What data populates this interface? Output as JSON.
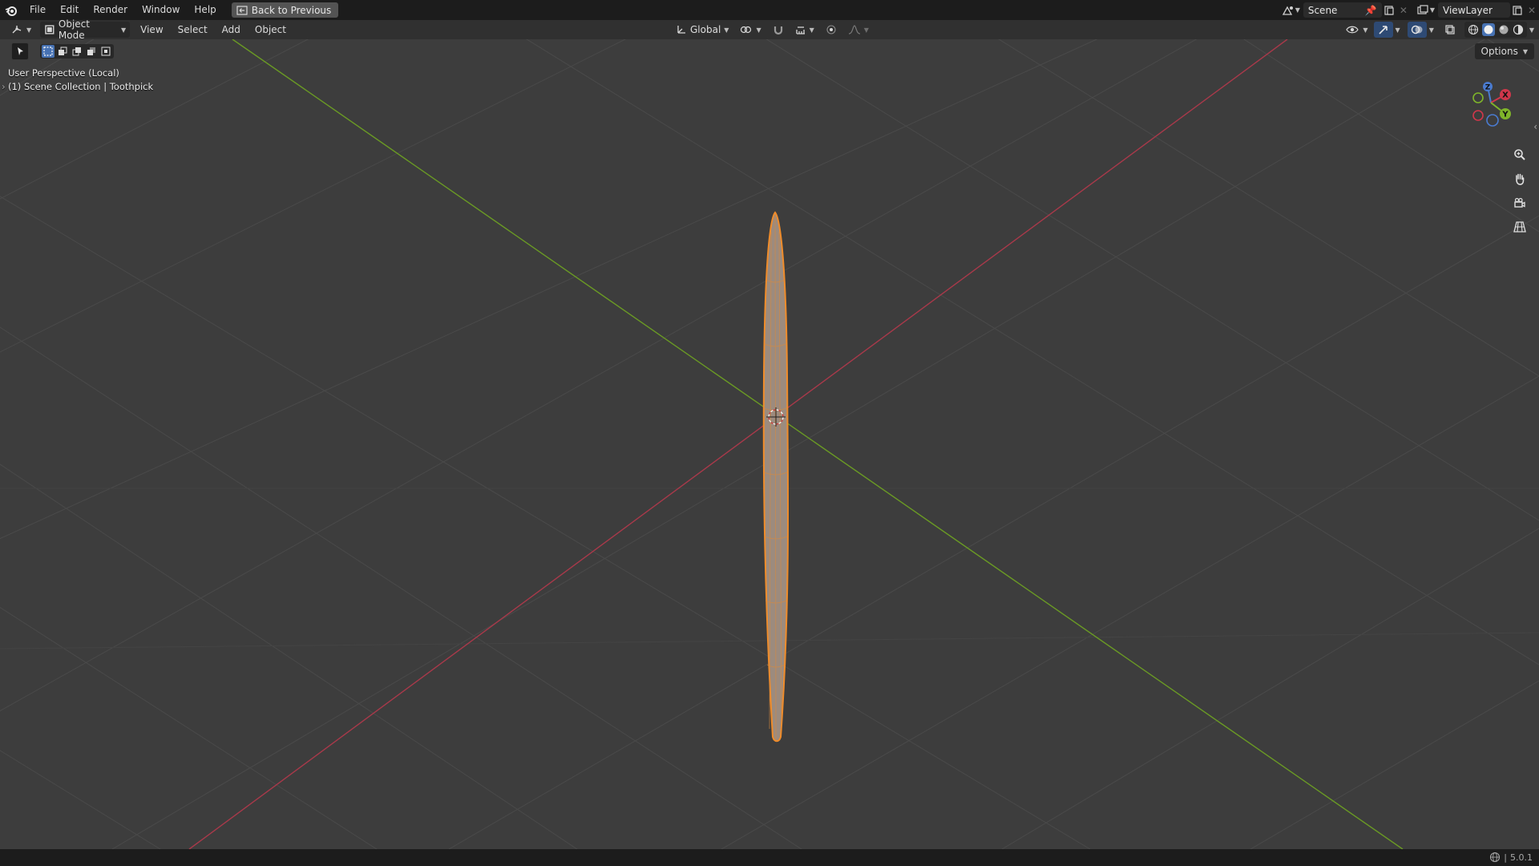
{
  "topbar": {
    "menu": [
      "File",
      "Edit",
      "Render",
      "Window",
      "Help"
    ],
    "back_label": "Back to Previous",
    "scene_name": "Scene",
    "view_layer_name": "ViewLayer"
  },
  "header": {
    "mode_label": "Object Mode",
    "menus": [
      "View",
      "Select",
      "Add",
      "Object"
    ],
    "transform_orientation": "Global"
  },
  "viewport": {
    "options_label": "Options",
    "perspective_text": "User Perspective (Local)",
    "collection_text": "(1) Scene Collection | Toothpick",
    "gizmo_axes": [
      "X",
      "Y",
      "Z"
    ]
  },
  "status": {
    "version": "5.0.1"
  },
  "colors": {
    "axis_x": "#a8394a",
    "axis_y": "#6a9a24",
    "selection": "#f08c2a",
    "header_bg": "#303030",
    "viewport_bg": "#3d3d3d"
  }
}
